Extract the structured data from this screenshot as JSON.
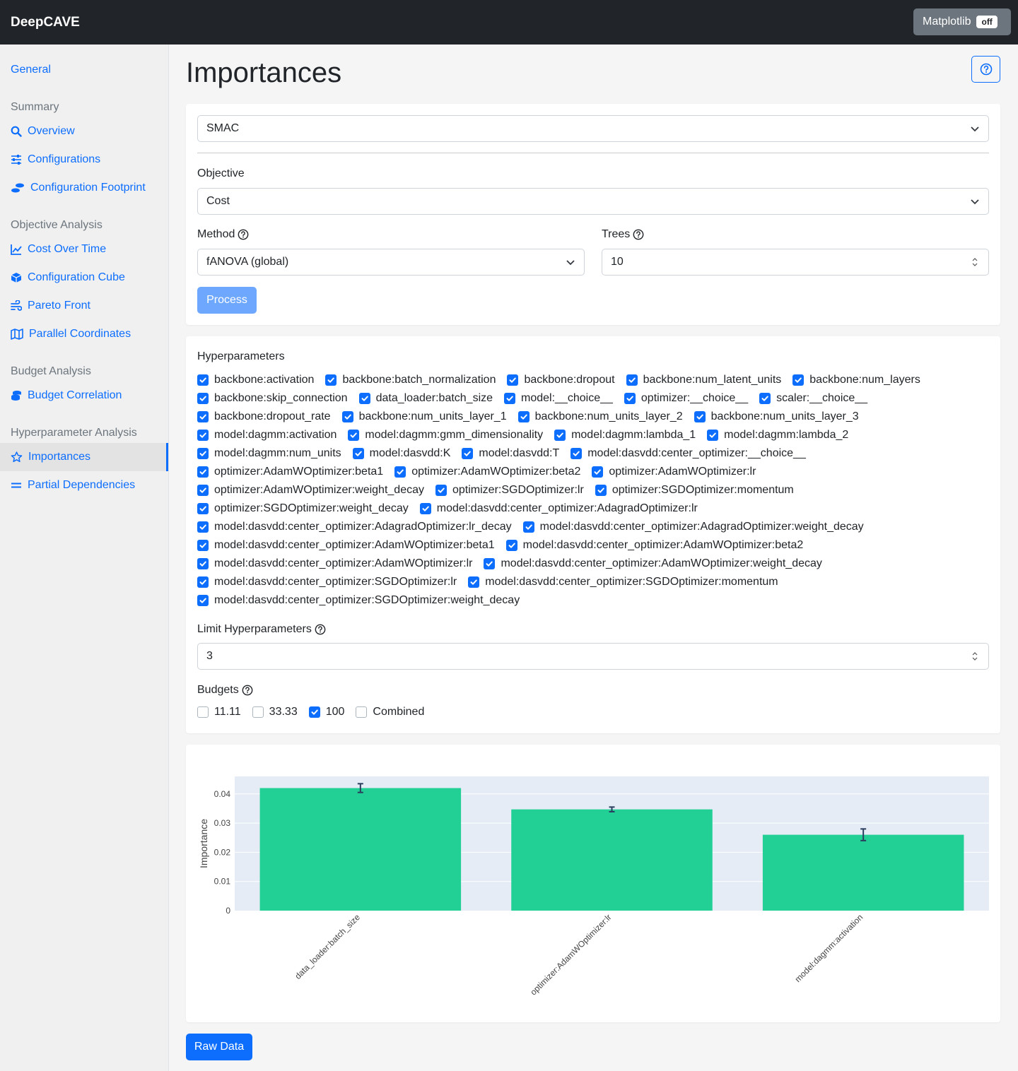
{
  "app": {
    "title": "DeepCAVE",
    "matplotlib_label": "Matplotlib",
    "matplotlib_state": "off"
  },
  "sidebar": {
    "general": "General",
    "sections": [
      {
        "heading": "Summary",
        "items": [
          "Overview",
          "Configurations",
          "Configuration Footprint"
        ]
      },
      {
        "heading": "Objective Analysis",
        "items": [
          "Cost Over Time",
          "Configuration Cube",
          "Pareto Front",
          "Parallel Coordinates"
        ]
      },
      {
        "heading": "Budget Analysis",
        "items": [
          "Budget Correlation"
        ]
      },
      {
        "heading": "Hyperparameter Analysis",
        "items": [
          "Importances",
          "Partial Dependencies"
        ]
      }
    ],
    "active_item": "Importances"
  },
  "page": {
    "title": "Importances"
  },
  "form": {
    "run_value": "SMAC",
    "objective_label": "Objective",
    "objective_value": "Cost",
    "method_label": "Method",
    "method_value": "fANOVA (global)",
    "trees_label": "Trees",
    "trees_value": "10",
    "process_label": "Process"
  },
  "hyperparameters": {
    "label": "Hyperparameters",
    "rows": [
      [
        "backbone:activation",
        "backbone:batch_normalization",
        "backbone:dropout",
        "backbone:num_latent_units",
        "backbone:num_layers"
      ],
      [
        "backbone:skip_connection",
        "data_loader:batch_size",
        "model:__choice__",
        "optimizer:__choice__",
        "scaler:__choice__"
      ],
      [
        "backbone:dropout_rate",
        "backbone:num_units_layer_1",
        "backbone:num_units_layer_2",
        "backbone:num_units_layer_3"
      ],
      [
        "model:dagmm:activation",
        "model:dagmm:gmm_dimensionality",
        "model:dagmm:lambda_1",
        "model:dagmm:lambda_2"
      ],
      [
        "model:dagmm:num_units",
        "model:dasvdd:K",
        "model:dasvdd:T",
        "model:dasvdd:center_optimizer:__choice__"
      ],
      [
        "optimizer:AdamWOptimizer:beta1",
        "optimizer:AdamWOptimizer:beta2",
        "optimizer:AdamWOptimizer:lr"
      ],
      [
        "optimizer:AdamWOptimizer:weight_decay",
        "optimizer:SGDOptimizer:lr",
        "optimizer:SGDOptimizer:momentum"
      ],
      [
        "optimizer:SGDOptimizer:weight_decay",
        "model:dasvdd:center_optimizer:AdagradOptimizer:lr"
      ],
      [
        "model:dasvdd:center_optimizer:AdagradOptimizer:lr_decay",
        "model:dasvdd:center_optimizer:AdagradOptimizer:weight_decay"
      ],
      [
        "model:dasvdd:center_optimizer:AdamWOptimizer:beta1",
        "model:dasvdd:center_optimizer:AdamWOptimizer:beta2"
      ],
      [
        "model:dasvdd:center_optimizer:AdamWOptimizer:lr",
        "model:dasvdd:center_optimizer:AdamWOptimizer:weight_decay"
      ],
      [
        "model:dasvdd:center_optimizer:SGDOptimizer:lr",
        "model:dasvdd:center_optimizer:SGDOptimizer:momentum"
      ],
      [
        "model:dasvdd:center_optimizer:SGDOptimizer:weight_decay"
      ]
    ],
    "all_checked": true,
    "limit_label": "Limit Hyperparameters",
    "limit_value": "3"
  },
  "budgets": {
    "label": "Budgets",
    "options": [
      {
        "label": "11.11",
        "checked": false
      },
      {
        "label": "33.33",
        "checked": false
      },
      {
        "label": "100",
        "checked": true
      },
      {
        "label": "Combined",
        "checked": false
      }
    ]
  },
  "chart_data": {
    "type": "bar",
    "categories": [
      "data_loader:batch_size",
      "optimizer:AdamWOptimizer:lr",
      "model:dagmm:activation"
    ],
    "values": [
      0.042,
      0.0347,
      0.026
    ],
    "errors": [
      0.0015,
      0.0008,
      0.002
    ],
    "ylabel": "Importance",
    "xlabel": "",
    "ylim": [
      0,
      0.046
    ],
    "yticks": [
      0,
      0.01,
      0.02,
      0.03,
      0.04
    ],
    "ytick_labels": [
      "0",
      "0.01",
      "0.02",
      "0.03",
      "0.04"
    ],
    "bar_color": "#22d096",
    "plot_bg": "#e5ecf6",
    "grid": true
  },
  "raw_data_label": "Raw Data",
  "colors": {
    "accent": "#0d6efd",
    "topbar": "#212529"
  }
}
